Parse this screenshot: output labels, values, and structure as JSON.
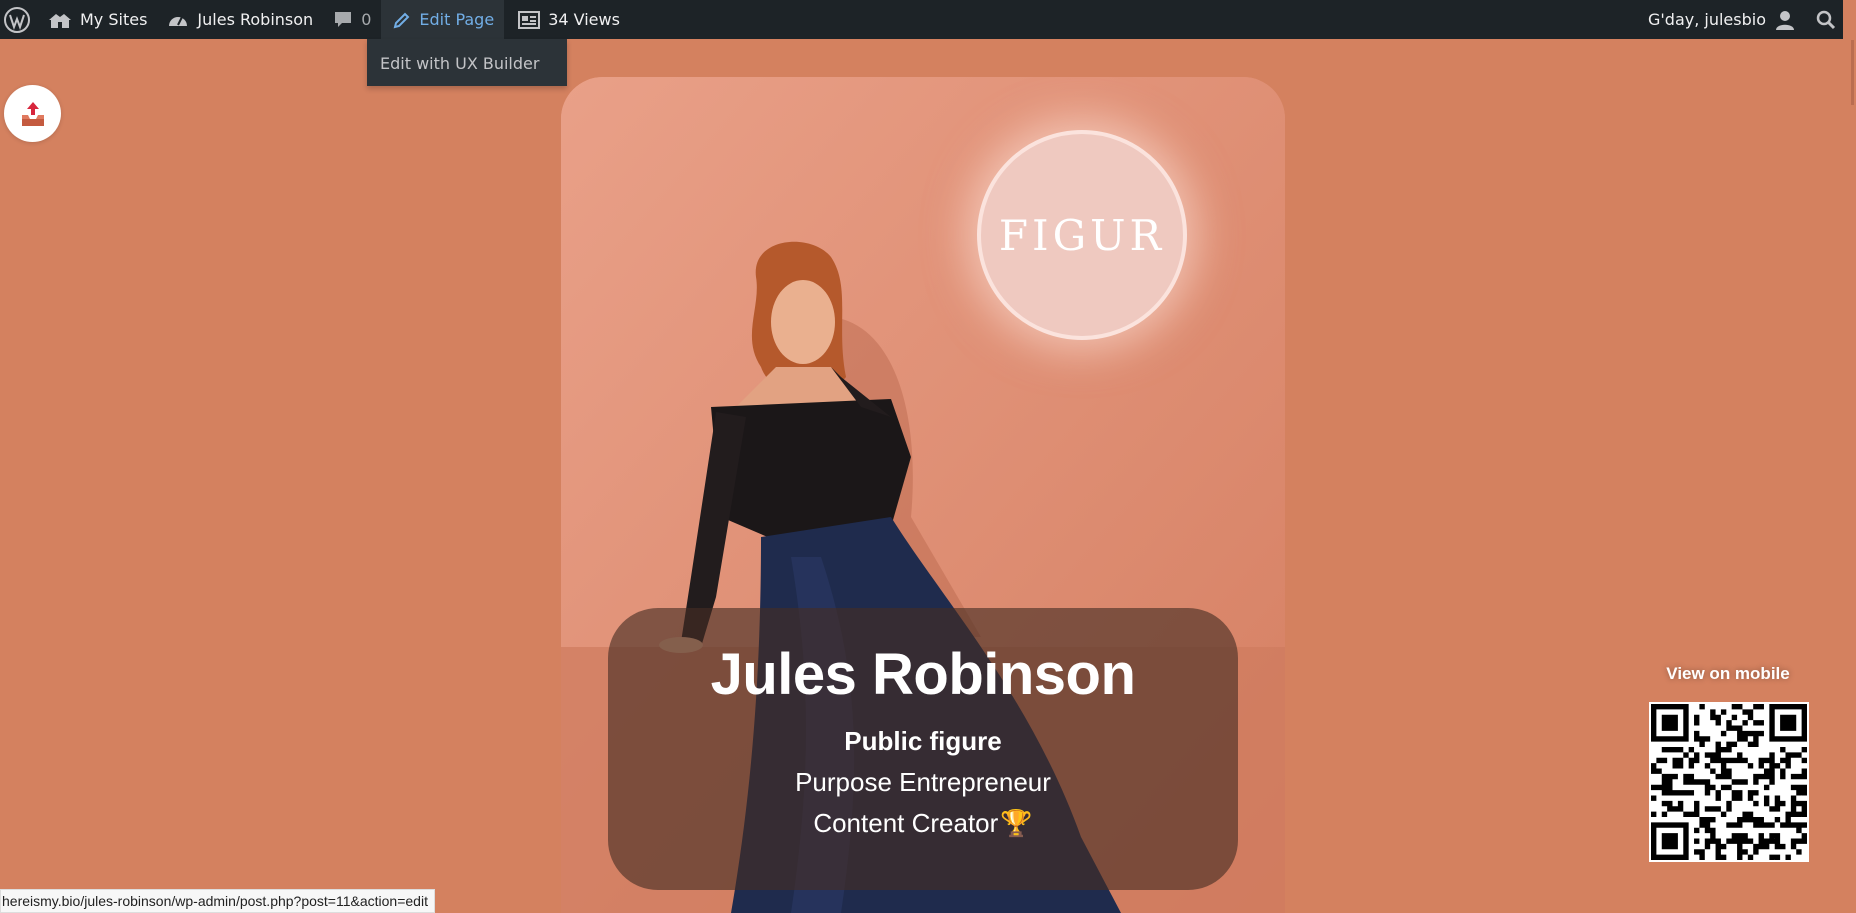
{
  "adminbar": {
    "wp_logo": "wordpress-icon",
    "my_sites": "My Sites",
    "site_name": "Jules Robinson",
    "comments_count": "0",
    "edit_page": "Edit Page",
    "views": "34 Views",
    "greeting": "G'day, julesbio"
  },
  "dropdown": {
    "ux_builder": "Edit with UX Builder"
  },
  "profile": {
    "logo_text": "FIGUR",
    "name": "Jules Robinson",
    "role_primary": "Public figure",
    "role_secondary": "Purpose Entrepreneur",
    "role_tertiary": "Content Creator",
    "role_tertiary_emoji": "🏆"
  },
  "mobile": {
    "label": "View on mobile"
  },
  "statusbar": {
    "url": "hereismy.bio/jules-robinson/wp-admin/post.php?post=11&action=edit"
  },
  "colors": {
    "background": "#d4815f",
    "adminbar": "#1d2327",
    "active_link": "#72aee6",
    "panel": "#462d23"
  }
}
